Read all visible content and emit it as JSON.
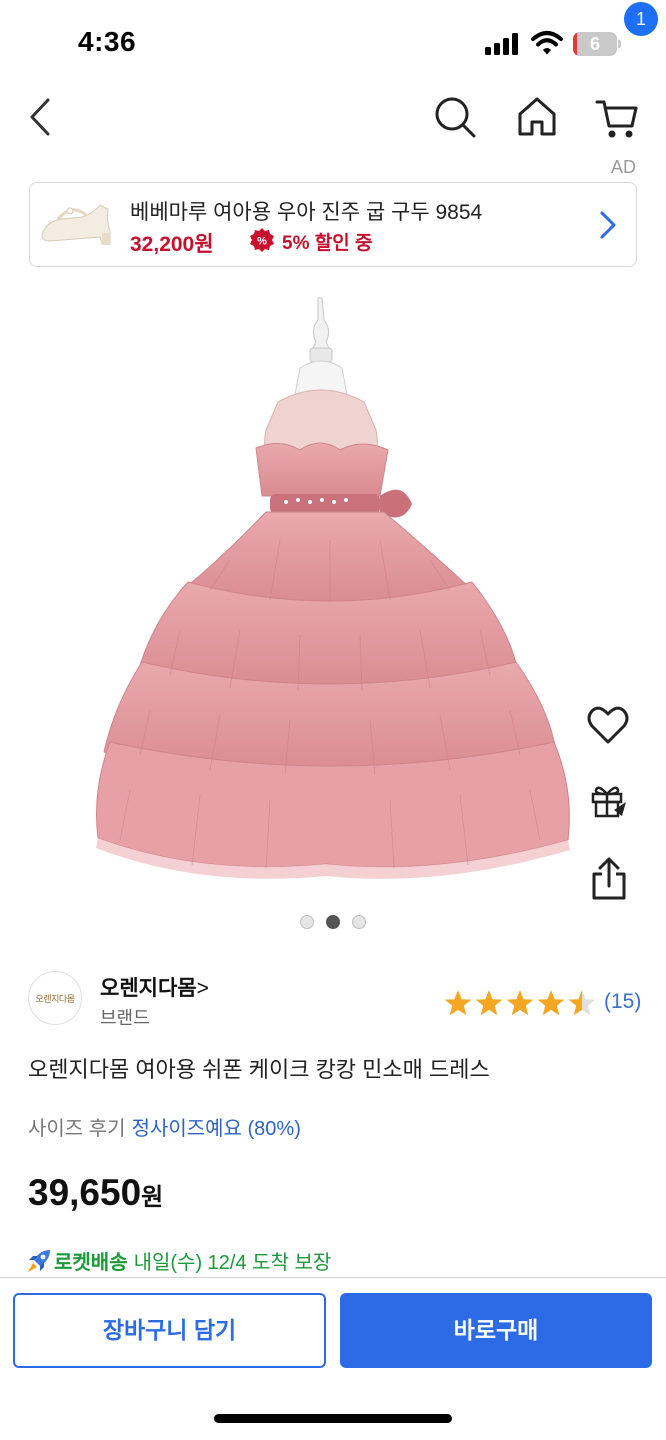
{
  "status_bar": {
    "time": "4:36",
    "battery_level": "6"
  },
  "nav": {
    "cart_badge": "1",
    "ad_tag": "AD"
  },
  "ad_banner": {
    "title": "베베마루 여아용 우아 진주 굽 구두 9854",
    "price": "32,200원",
    "discount": "5% 할인 중",
    "accent_color": "#c8102e"
  },
  "gallery": {
    "dots": 3,
    "active_index": 1
  },
  "seller": {
    "logo_text": "오렌지다몸",
    "name": "오렌지다몸",
    "chevron": ">",
    "type": "브랜드"
  },
  "rating": {
    "stars": 4.5,
    "count": "(15)"
  },
  "product": {
    "title": "오렌지다몸 여아용 쉬폰 케이크 캉캉 민소매 드레스",
    "size_review_label": "사이즈 후기",
    "size_review_value": "정사이즈예요 (80%)",
    "price_number": "39,650",
    "price_unit": "원"
  },
  "delivery": {
    "brand": "로켓배송",
    "text": "내일(수) 12/4 도착 보장"
  },
  "actions": {
    "cart_button": "장바구니 담기",
    "buy_button": "바로구매",
    "primary_color": "#2c6be5"
  }
}
